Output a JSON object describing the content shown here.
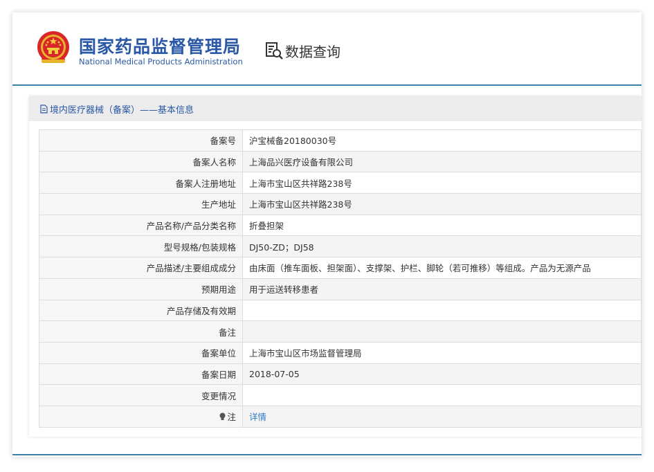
{
  "header": {
    "title_cn": "国家药品监督管理局",
    "title_en": "National Medical Products Administration",
    "query_label": "数据查询",
    "emblem_icon": "national-emblem-icon",
    "query_icon": "document-search-icon"
  },
  "panel": {
    "title": "境内医疗器械（备案）——基本信息",
    "title_icon": "document-icon"
  },
  "rows": [
    {
      "label": "备案号",
      "value": "沪宝械备20180030号"
    },
    {
      "label": "备案人名称",
      "value": "上海品兴医疗设备有限公司"
    },
    {
      "label": "备案人注册地址",
      "value": "上海市宝山区共祥路238号"
    },
    {
      "label": "生产地址",
      "value": "上海市宝山区共祥路238号"
    },
    {
      "label": "产品名称/产品分类名称",
      "value": "折叠担架"
    },
    {
      "label": "型号规格/包装规格",
      "value": "DJ50-ZD；DJ58"
    },
    {
      "label": "产品描述/主要组成成分",
      "value": "由床面（推车面板、担架面）、支撑架、护栏、脚轮（若可推移）等组成。产品为无源产品"
    },
    {
      "label": "预期用途",
      "value": "用于运送转移患者"
    },
    {
      "label": "产品存储及有效期",
      "value": ""
    },
    {
      "label": "备注",
      "value": ""
    },
    {
      "label": "备案单位",
      "value": "上海市宝山区市场监督管理局"
    },
    {
      "label": "备案日期",
      "value": "2018-07-05"
    },
    {
      "label": "变更情况",
      "value": ""
    }
  ],
  "note_row": {
    "label": "注",
    "link": "详情",
    "icon": "lightbulb-icon"
  },
  "colors": {
    "brand": "#2a57a6",
    "rule": "#3d7fa6",
    "link": "#2e7cc5"
  }
}
